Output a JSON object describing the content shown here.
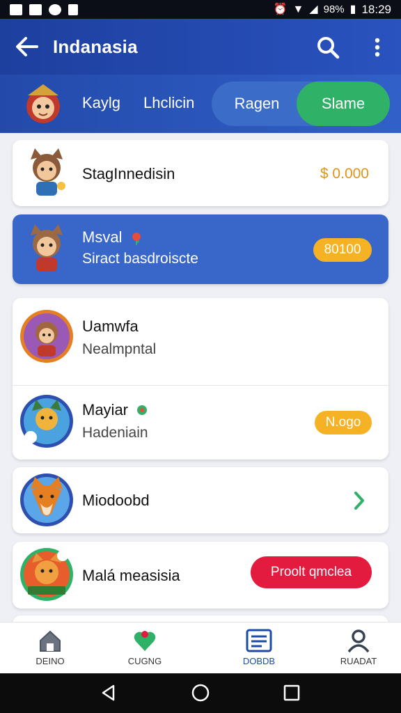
{
  "status_bar": {
    "time": "18:29",
    "battery": "98%"
  },
  "app_bar": {
    "title": "Indanasia"
  },
  "tabs": [
    {
      "label": "Kaylg"
    },
    {
      "label": "Lhclicin"
    },
    {
      "label": "Ragen"
    },
    {
      "label": "Slame",
      "active": true
    }
  ],
  "list": {
    "card1": {
      "title": "StagInnedisin",
      "price": "$ 0.000"
    },
    "card2": {
      "title": "Msval",
      "subtitle": "Siract basdroiscte",
      "badge": "80100"
    },
    "card3a": {
      "title": "Uamwfa",
      "subtitle": "Nealmpntal"
    },
    "card3b": {
      "title": "Mayiar",
      "subtitle": "Hadeniain",
      "badge": "N.ogo"
    },
    "card4": {
      "title": "Miodoobd"
    },
    "card5": {
      "title": "Malá measisia",
      "button": "Proolt qmclea"
    }
  },
  "bottom_nav": [
    {
      "label": "DEINO",
      "icon": "home-icon"
    },
    {
      "label": "CUGNG",
      "icon": "heart-leaf-icon"
    },
    {
      "label": "DOBDB",
      "icon": "list-icon",
      "active": true
    },
    {
      "label": "RUADAT",
      "icon": "profile-icon"
    }
  ],
  "colors": {
    "primary": "#2a53bf",
    "active_tab": "#2fb268",
    "badge": "#f4b224",
    "alert": "#e31b3e"
  }
}
